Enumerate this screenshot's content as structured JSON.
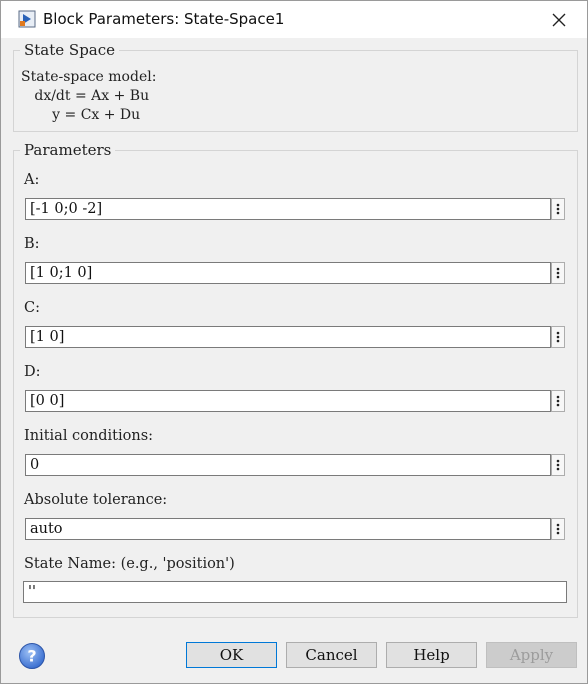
{
  "window": {
    "title": "Block Parameters: State-Space1"
  },
  "description_group": {
    "legend": "State Space",
    "text": "State-space model:\n   dx/dt = Ax + Bu\n       y = Cx + Du"
  },
  "parameters_group": {
    "legend": "Parameters",
    "fields": [
      {
        "label": "A:",
        "value": "[-1 0;0 -2]"
      },
      {
        "label": "B:",
        "value": "[1 0;1 0]"
      },
      {
        "label": "C:",
        "value": "[1 0]"
      },
      {
        "label": "D:",
        "value": "[0 0]"
      },
      {
        "label": "Initial conditions:",
        "value": "0"
      },
      {
        "label": "Absolute tolerance:",
        "value": "auto"
      },
      {
        "label": "State Name: (e.g., 'position')",
        "value": "''"
      }
    ]
  },
  "buttons": {
    "ok": "OK",
    "cancel": "Cancel",
    "help": "Help",
    "apply": "Apply"
  },
  "colors": {
    "dialog_bg": "#f0f0f0",
    "field_border": "#7a7a7a",
    "help_icon_blue": "#3b6fd0",
    "default_button_border": "#0078d7"
  },
  "icons": {
    "app": "simulink-block-icon",
    "close": "close-icon",
    "help": "question-circle-icon",
    "field_menu": "vertical-ellipsis-icon"
  }
}
